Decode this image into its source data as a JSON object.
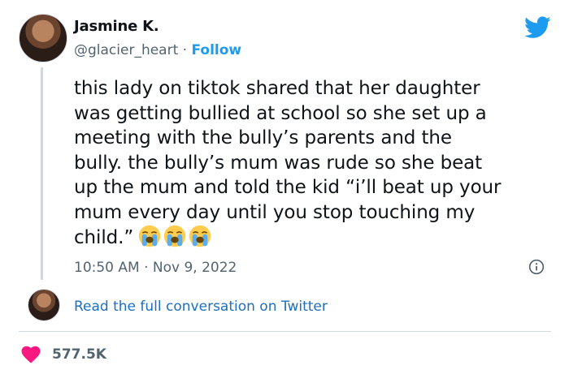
{
  "author": {
    "name": "Jasmine K.",
    "handle": "@glacier_heart",
    "separator": " · ",
    "follow_label": "Follow"
  },
  "tweet": {
    "text": "this lady on tiktok shared that her daughter\nwas getting bullied at school so she set up a\nmeeting with the bully’s parents and the\nbully. the bully’s mum was rude so she beat\nup the mum and told the kid “i’ll beat up your\nmum every day until you stop touching my\nchild.”",
    "emojis": [
      "loudly-crying-face",
      "loudly-crying-face",
      "loudly-crying-face"
    ],
    "timestamp": "10:50 AM · Nov 9, 2022"
  },
  "conversation_link": "Read the full conversation on Twitter",
  "likes_count": "577.5K",
  "colors": {
    "accent": "#1d9bf0",
    "heart": "#f91880",
    "muted_text": "#536471",
    "divider": "#cfd9de"
  },
  "icons": [
    "twitter-bird-icon",
    "info-icon",
    "heart-icon"
  ]
}
